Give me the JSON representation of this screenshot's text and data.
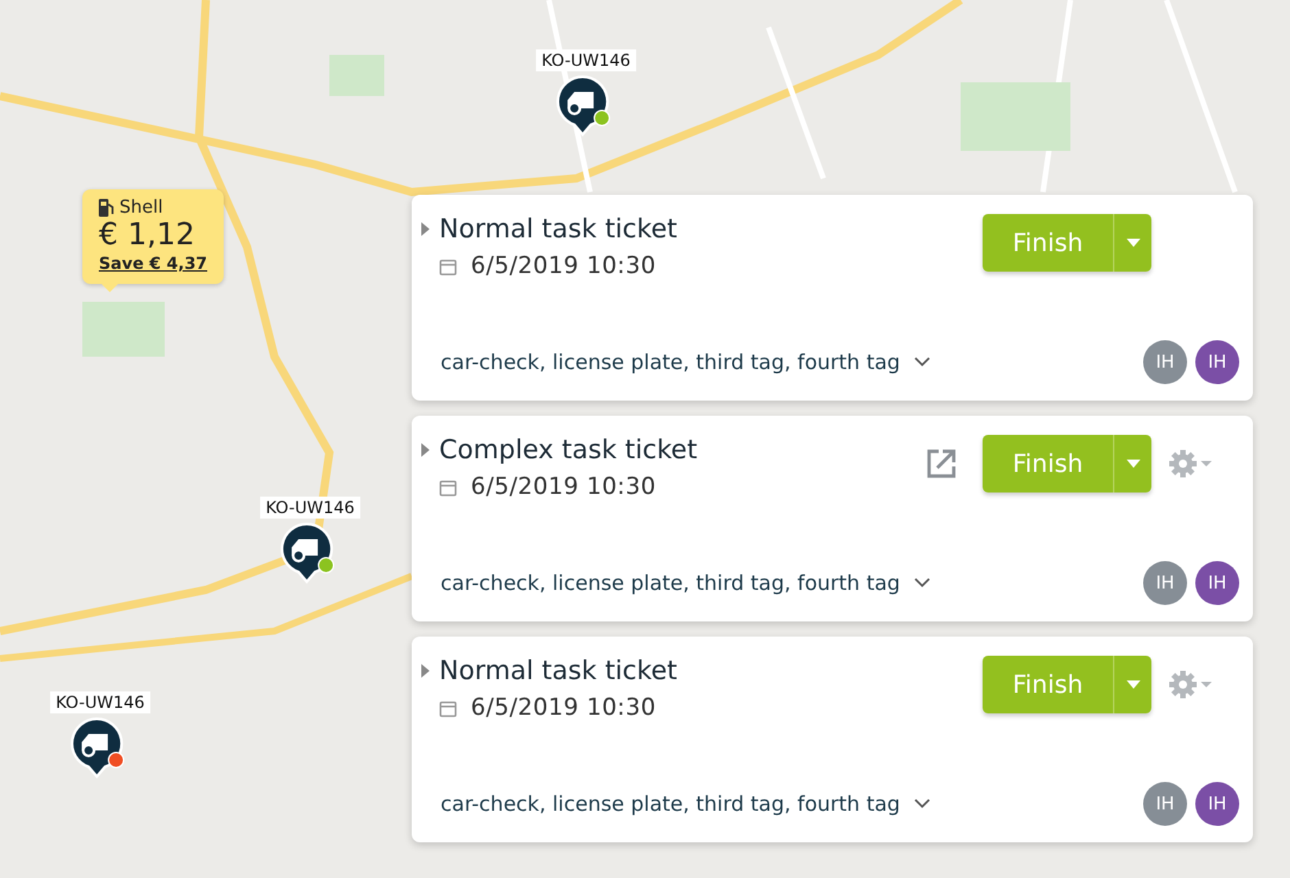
{
  "markers": [
    {
      "label": "KO-UW146",
      "color": "#8cc320"
    },
    {
      "label": "KO-UW146",
      "color": "#8cc320"
    },
    {
      "label": "KO-UW146",
      "color": "#f04e23"
    }
  ],
  "fuel_tooltip": {
    "brand": "Shell",
    "price": "€ 1,12",
    "saving": "Save € 4,37"
  },
  "tickets": [
    {
      "title": "Normal task ticket",
      "expanded": false,
      "date": "6/5/2019 10:30",
      "button": "Finish",
      "external_link": false,
      "settings": false,
      "tags": "car-check, license plate, third tag, fourth tag",
      "assignees": [
        {
          "initials": "IH",
          "color": "#868e96"
        },
        {
          "initials": "IH",
          "color": "#7b4fa6"
        }
      ]
    },
    {
      "title": "Complex task ticket",
      "expanded": false,
      "date": "6/5/2019 10:30",
      "button": "Finish",
      "external_link": true,
      "settings": true,
      "tags": "car-check, license plate, third tag, fourth tag",
      "assignees": [
        {
          "initials": "IH",
          "color": "#868e96"
        },
        {
          "initials": "IH",
          "color": "#7b4fa6"
        }
      ]
    },
    {
      "title": "Normal task ticket",
      "expanded": false,
      "date": "6/5/2019 10:30",
      "button": "Finish",
      "external_link": false,
      "settings": true,
      "tags": "car-check, license plate, third tag, fourth tag",
      "assignees": [
        {
          "initials": "IH",
          "color": "#868e96"
        },
        {
          "initials": "IH",
          "color": "#7b4fa6"
        }
      ]
    }
  ]
}
